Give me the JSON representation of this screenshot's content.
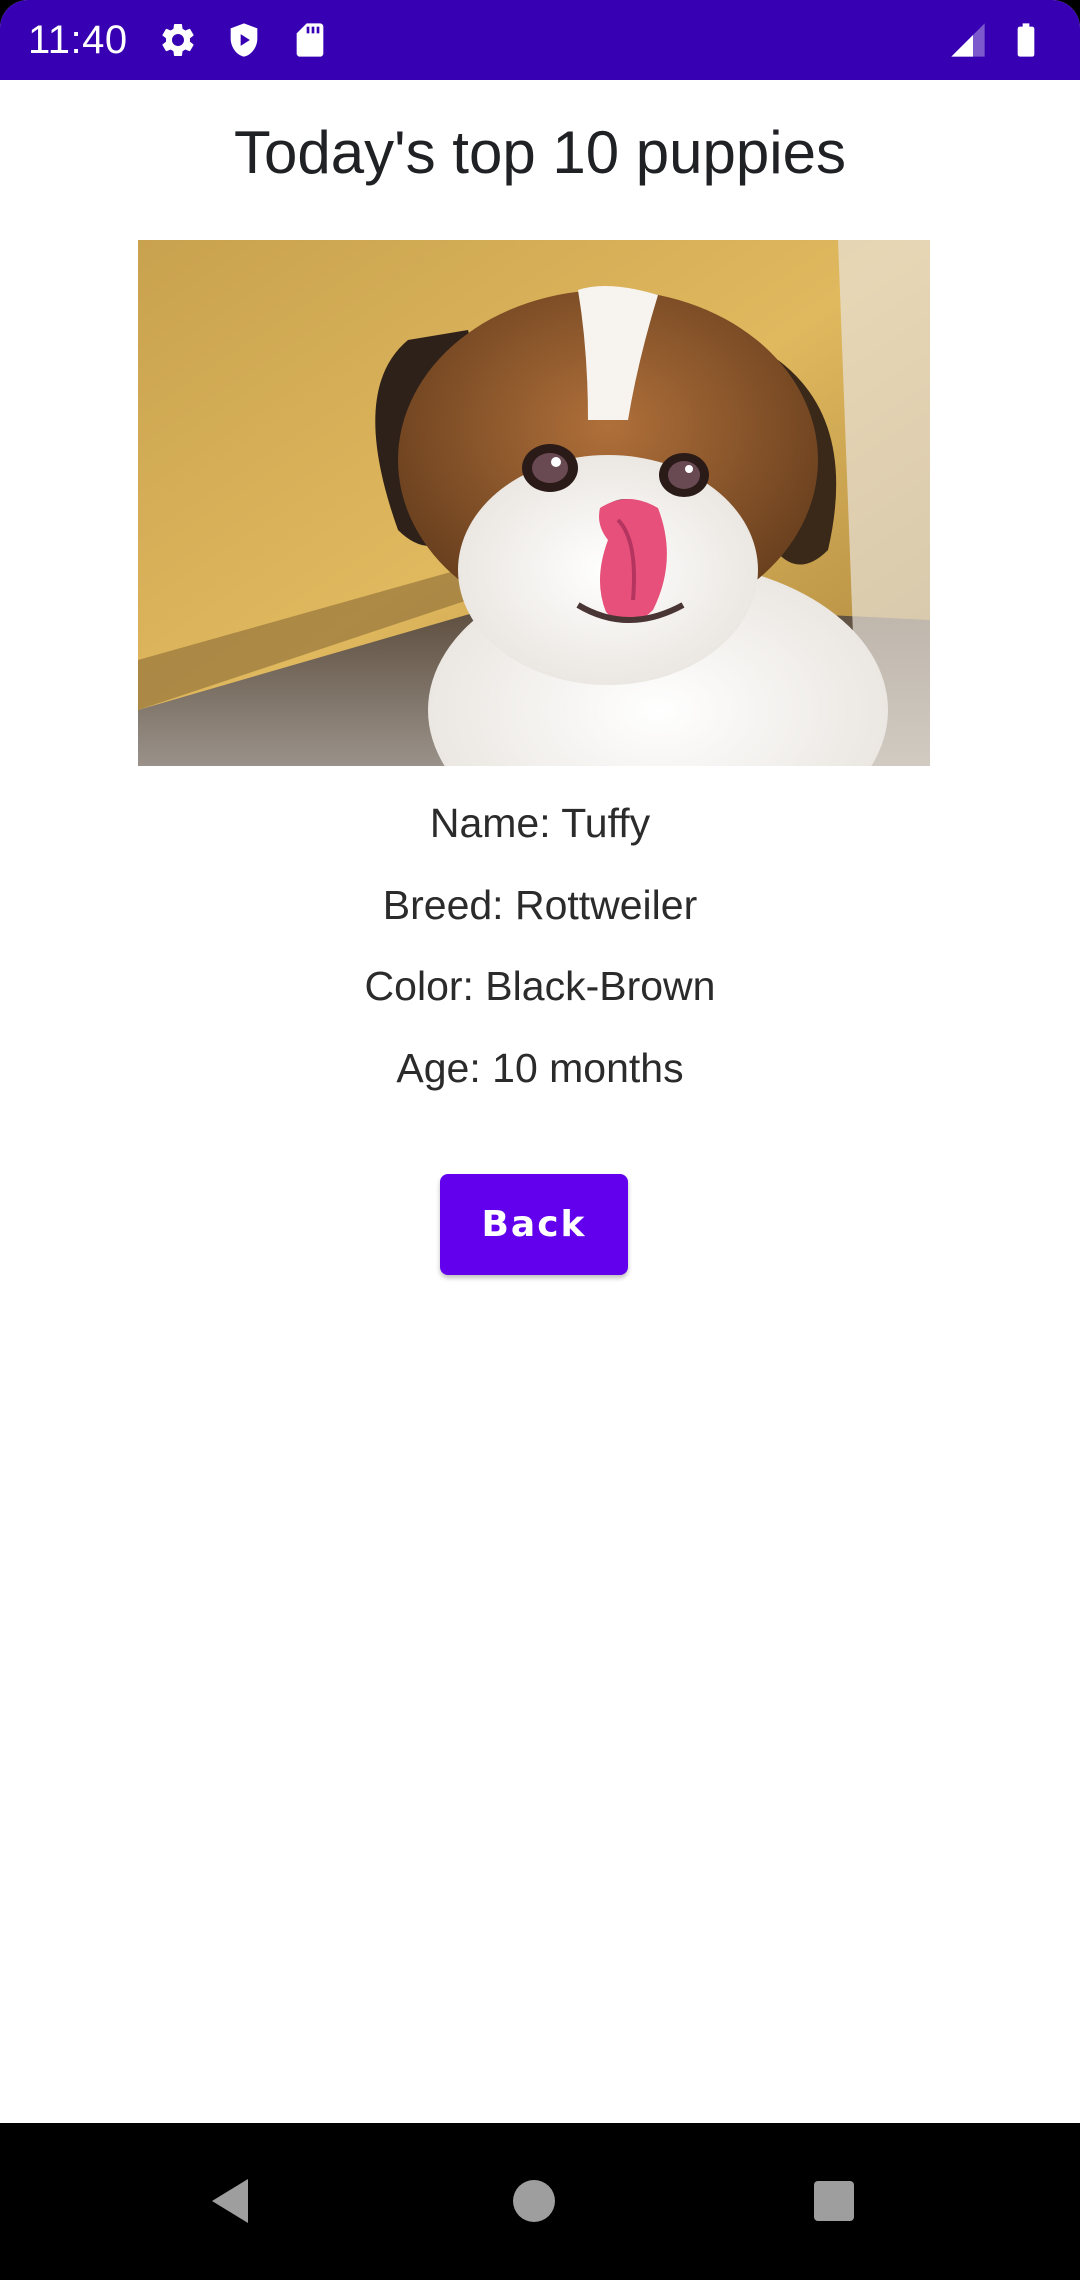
{
  "status_bar": {
    "time": "11:40",
    "icons": [
      "gear-icon",
      "shield-icon",
      "sd-card-icon",
      "signal-icon",
      "battery-icon"
    ],
    "background": "#3700b3"
  },
  "main": {
    "title": "Today's top 10 puppies",
    "photo_subject": "puppy-photo",
    "details": {
      "name": "Name: Tuffy",
      "breed": "Breed: Rottweiler",
      "color": "Color: Black-Brown",
      "age": "Age: 10 months"
    },
    "back_label": "Back",
    "accent": "#6200ee"
  },
  "nav_bar": {
    "buttons": [
      "back-nav-icon",
      "home-nav-icon",
      "recents-nav-icon"
    ]
  }
}
